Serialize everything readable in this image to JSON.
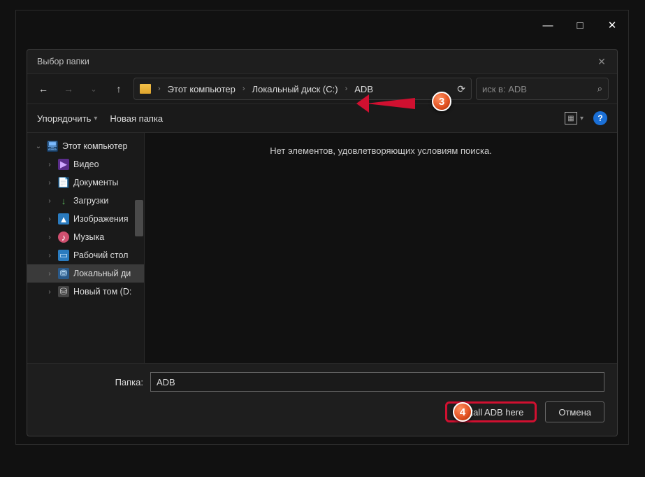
{
  "outer": {
    "minimize": "—",
    "maximize": "□",
    "close": "✕"
  },
  "dialog": {
    "title": "Выбор папки",
    "close": "✕"
  },
  "nav": {
    "back": "←",
    "forward": "→",
    "up": "↑",
    "breadcrumb": {
      "root": "Этот компьютер",
      "drive": "Локальный диск (C:)",
      "folder": "ADB"
    },
    "refresh": "⟳",
    "search_placeholder": "иск в: ADB",
    "search_icon": "⌕"
  },
  "toolbar": {
    "organize": "Упорядочить",
    "new_folder": "Новая папка",
    "view_chev": "▾",
    "help": "?"
  },
  "sidebar": {
    "items": [
      {
        "chev": "⌄",
        "icon": "ic-pc",
        "glyph": "🖥",
        "label": "Этот компьютер"
      },
      {
        "chev": "›",
        "icon": "ic-video",
        "glyph": "▶",
        "label": "Видео"
      },
      {
        "chev": "›",
        "icon": "ic-doc",
        "glyph": "📄",
        "label": "Документы"
      },
      {
        "chev": "›",
        "icon": "ic-dl",
        "glyph": "↓",
        "label": "Загрузки"
      },
      {
        "chev": "›",
        "icon": "ic-img",
        "glyph": "▲",
        "label": "Изображения"
      },
      {
        "chev": "›",
        "icon": "ic-music",
        "glyph": "♪",
        "label": "Музыка"
      },
      {
        "chev": "›",
        "icon": "ic-desk",
        "glyph": "▭",
        "label": "Рабочий стол"
      },
      {
        "chev": "›",
        "icon": "ic-drive",
        "glyph": "⛃",
        "label": "Локальный ди",
        "selected": true
      },
      {
        "chev": "›",
        "icon": "ic-drive2",
        "glyph": "⛁",
        "label": "Новый том (D:"
      }
    ]
  },
  "main": {
    "empty_text": "Нет элементов, удовлетворяющих условиям поиска."
  },
  "bottom": {
    "folder_label": "Папка:",
    "folder_value": "ADB",
    "install_btn": "Install ADB here",
    "cancel_btn": "Отмена"
  },
  "markers": {
    "m3": "3",
    "m4": "4"
  }
}
